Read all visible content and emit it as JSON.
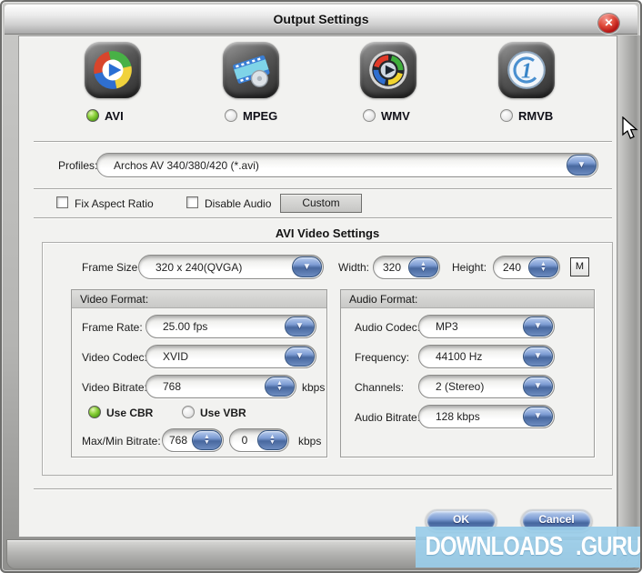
{
  "window": {
    "title": "Output Settings"
  },
  "icons": {
    "close": "✕",
    "dropdown_arrow": "▼",
    "spin_up": "▲",
    "spin_down": "▼"
  },
  "formats": {
    "avi": {
      "label": "AVI",
      "selected": true
    },
    "mpeg": {
      "label": "MPEG",
      "selected": false
    },
    "wmv": {
      "label": "WMV",
      "selected": false
    },
    "rmvb": {
      "label": "RMVB",
      "selected": false
    }
  },
  "profiles": {
    "label": "Profiles:",
    "value": "Archos AV 340/380/420 (*.avi)"
  },
  "options": {
    "fix_aspect_ratio": "Fix Aspect Ratio",
    "disable_audio": "Disable Audio",
    "custom": "Custom"
  },
  "avi_settings": {
    "heading": "AVI Video Settings",
    "frame_size_label": "Frame Size",
    "frame_size_value": "320 x 240(QVGA)",
    "width_label": "Width:",
    "width_value": "320",
    "height_label": "Height:",
    "height_value": "240",
    "m_button": "M",
    "video_format": {
      "title": "Video Format:",
      "frame_rate_label": "Frame Rate:",
      "frame_rate_value": "25.00 fps",
      "video_codec_label": "Video Codec:",
      "video_codec_value": "XVID",
      "video_bitrate_label": "Video Bitrate:",
      "video_bitrate_value": "768",
      "video_bitrate_unit": "kbps",
      "use_cbr": "Use CBR",
      "use_vbr": "Use VBR",
      "maxmin_label": "Max/Min Bitrate:",
      "max_value": "768",
      "min_value": "0",
      "maxmin_unit": "kbps"
    },
    "audio_format": {
      "title": "Audio Format:",
      "audio_codec_label": "Audio Codec:",
      "audio_codec_value": "MP3",
      "frequency_label": "Frequency:",
      "frequency_value": "44100 Hz",
      "channels_label": "Channels:",
      "channels_value": "2 (Stereo)",
      "audio_bitrate_label": "Audio Bitrate:",
      "audio_bitrate_value": "128 kbps"
    }
  },
  "buttons": {
    "ok": "OK",
    "cancel": "Cancel"
  },
  "watermark": {
    "left": "DOWNLOADS",
    "right": ".GURU"
  },
  "state": {
    "selected_format": "AVI",
    "bitrate_mode": "CBR"
  },
  "colors": {
    "accent_blue": "#48689f",
    "radio_green": "#4d9c12",
    "banner_blue": "#9acde9",
    "close_red": "#b31414"
  }
}
